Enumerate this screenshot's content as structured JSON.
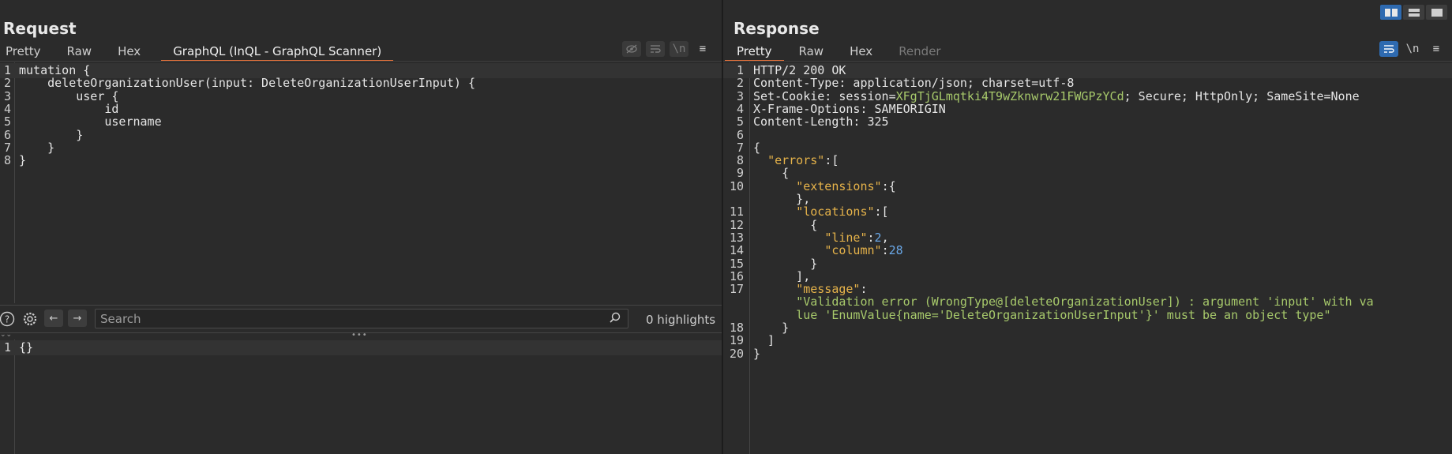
{
  "request": {
    "title": "Request",
    "tabs": [
      "Pretty",
      "Raw",
      "Hex",
      "GraphQL (InQL - GraphQL Scanner)"
    ],
    "toolbar_icons": [
      "eye-off-icon",
      "wrap-lines-icon",
      "newline-icon",
      "menu-icon"
    ],
    "newline_label": "\\n",
    "menu_label": "≡",
    "code_lines": [
      {
        "n": "1",
        "text": "mutation {"
      },
      {
        "n": "2",
        "text": "    deleteOrganizationUser(input: DeleteOrganizationUserInput) {"
      },
      {
        "n": "3",
        "text": "        user {"
      },
      {
        "n": "4",
        "text": "            id"
      },
      {
        "n": "5",
        "text": "            username"
      },
      {
        "n": "6",
        "text": "        }"
      },
      {
        "n": "7",
        "text": "    }"
      },
      {
        "n": "8",
        "text": "}"
      }
    ],
    "search": {
      "placeholder": "Search",
      "highlights": "0 highlights",
      "help_label": "?",
      "settings_label": "⚙",
      "prev_label": "←",
      "next_label": "→",
      "search_icon_label": "⌕"
    },
    "variables_lines": [
      {
        "n": "1",
        "text": "{}"
      }
    ]
  },
  "response": {
    "title": "Response",
    "tabs": [
      "Pretty",
      "Raw",
      "Hex",
      "Render"
    ],
    "toolbar_icons": [
      "wrap-lines-icon",
      "newline-icon",
      "menu-icon"
    ],
    "newline_label": "\\n",
    "menu_label": "≡",
    "lines": [
      {
        "n": "1",
        "parts": [
          {
            "c": "k",
            "t": "HTTP/2 200 OK"
          }
        ]
      },
      {
        "n": "2",
        "parts": [
          {
            "c": "k",
            "t": "Content-Type: application/json; charset=utf-8"
          }
        ]
      },
      {
        "n": "3",
        "parts": [
          {
            "c": "k",
            "t": "Set-Cookie: session="
          },
          {
            "c": "ck",
            "t": "XFgTjGLmqtki4T9wZknwrw21FWGPzYCd"
          },
          {
            "c": "k",
            "t": "; Secure; HttpOnly; SameSite=None"
          }
        ]
      },
      {
        "n": "4",
        "parts": [
          {
            "c": "k",
            "t": "X-Frame-Options: SAMEORIGIN"
          }
        ]
      },
      {
        "n": "5",
        "parts": [
          {
            "c": "k",
            "t": "Content-Length: 325"
          }
        ]
      },
      {
        "n": "6",
        "parts": [
          {
            "c": "k",
            "t": ""
          }
        ]
      },
      {
        "n": "7",
        "parts": [
          {
            "c": "k",
            "t": "{"
          }
        ]
      },
      {
        "n": "8",
        "parts": [
          {
            "c": "k",
            "t": "  "
          },
          {
            "c": "s",
            "t": "\"errors\""
          },
          {
            "c": "k",
            "t": ":["
          }
        ]
      },
      {
        "n": "9",
        "parts": [
          {
            "c": "k",
            "t": "    {"
          }
        ]
      },
      {
        "n": "10",
        "parts": [
          {
            "c": "k",
            "t": "      "
          },
          {
            "c": "s",
            "t": "\"extensions\""
          },
          {
            "c": "k",
            "t": ":{"
          }
        ]
      },
      {
        "n": "",
        "parts": [
          {
            "c": "k",
            "t": "      },"
          }
        ]
      },
      {
        "n": "11",
        "parts": [
          {
            "c": "k",
            "t": "      "
          },
          {
            "c": "s",
            "t": "\"locations\""
          },
          {
            "c": "k",
            "t": ":["
          }
        ]
      },
      {
        "n": "12",
        "parts": [
          {
            "c": "k",
            "t": "        {"
          }
        ]
      },
      {
        "n": "13",
        "parts": [
          {
            "c": "k",
            "t": "          "
          },
          {
            "c": "s",
            "t": "\"line\""
          },
          {
            "c": "k",
            "t": ":"
          },
          {
            "c": "num",
            "t": "2"
          },
          {
            "c": "k",
            "t": ","
          }
        ]
      },
      {
        "n": "14",
        "parts": [
          {
            "c": "k",
            "t": "          "
          },
          {
            "c": "s",
            "t": "\"column\""
          },
          {
            "c": "k",
            "t": ":"
          },
          {
            "c": "num",
            "t": "28"
          }
        ]
      },
      {
        "n": "15",
        "parts": [
          {
            "c": "k",
            "t": "        }"
          }
        ]
      },
      {
        "n": "16",
        "parts": [
          {
            "c": "k",
            "t": "      ],"
          }
        ]
      },
      {
        "n": "17",
        "parts": [
          {
            "c": "k",
            "t": "      "
          },
          {
            "c": "s",
            "t": "\"message\""
          },
          {
            "c": "k",
            "t": ":"
          }
        ]
      },
      {
        "n": "",
        "parts": [
          {
            "c": "k",
            "t": "      "
          },
          {
            "c": "str",
            "t": "\"Validation error (WrongType@[deleteOrganizationUser]) : argument 'input' with va"
          }
        ]
      },
      {
        "n": "",
        "parts": [
          {
            "c": "k",
            "t": "      "
          },
          {
            "c": "str",
            "t": "lue 'EnumValue{name='DeleteOrganizationUserInput'}' must be an object type\""
          }
        ]
      },
      {
        "n": "18",
        "parts": [
          {
            "c": "k",
            "t": "    }"
          }
        ]
      },
      {
        "n": "19",
        "parts": [
          {
            "c": "k",
            "t": "  ]"
          }
        ]
      },
      {
        "n": "20",
        "parts": [
          {
            "c": "k",
            "t": "}"
          }
        ]
      }
    ]
  },
  "layout_buttons": [
    "split-horizontal-icon",
    "split-vertical-icon",
    "single-pane-icon"
  ],
  "colors": {
    "accent_tab": "#e0703a",
    "accent_blue": "#2e6ab0",
    "json_key": "#e6b34a",
    "json_string": "#a7c96b",
    "json_number": "#6aa8e8"
  }
}
